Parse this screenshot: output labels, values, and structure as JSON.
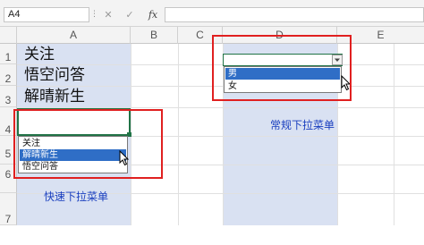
{
  "formula_bar": {
    "name_box": "A4",
    "cancel_glyph": "✕",
    "confirm_glyph": "✓",
    "fx_label": "fx",
    "formula_value": ""
  },
  "columns": [
    "A",
    "B",
    "C",
    "D",
    "E"
  ],
  "rows": [
    "1",
    "2",
    "3",
    "4",
    "5",
    "6",
    "7"
  ],
  "cells": {
    "a1": "关注",
    "a2": "悟空问答",
    "a3": "解晴新生"
  },
  "quick_dropdown": {
    "items": [
      "关注",
      "解晴新生",
      "悟空问答"
    ],
    "selected_index": 1
  },
  "normal_dropdown": {
    "items": [
      "男",
      "女"
    ],
    "selected_index": 0
  },
  "annotations": {
    "quick": "快速下拉菜单",
    "normal": "常规下拉菜单"
  },
  "icons": [
    "dropdown-arrow-icon",
    "mouse-pointer-icon"
  ],
  "colors": {
    "column_fill": "#d9e1f2",
    "highlight_border": "#e02020",
    "selected_item": "#2f6ec6",
    "annotation_text": "#1a3fbf",
    "active_cell_border": "#217346"
  }
}
